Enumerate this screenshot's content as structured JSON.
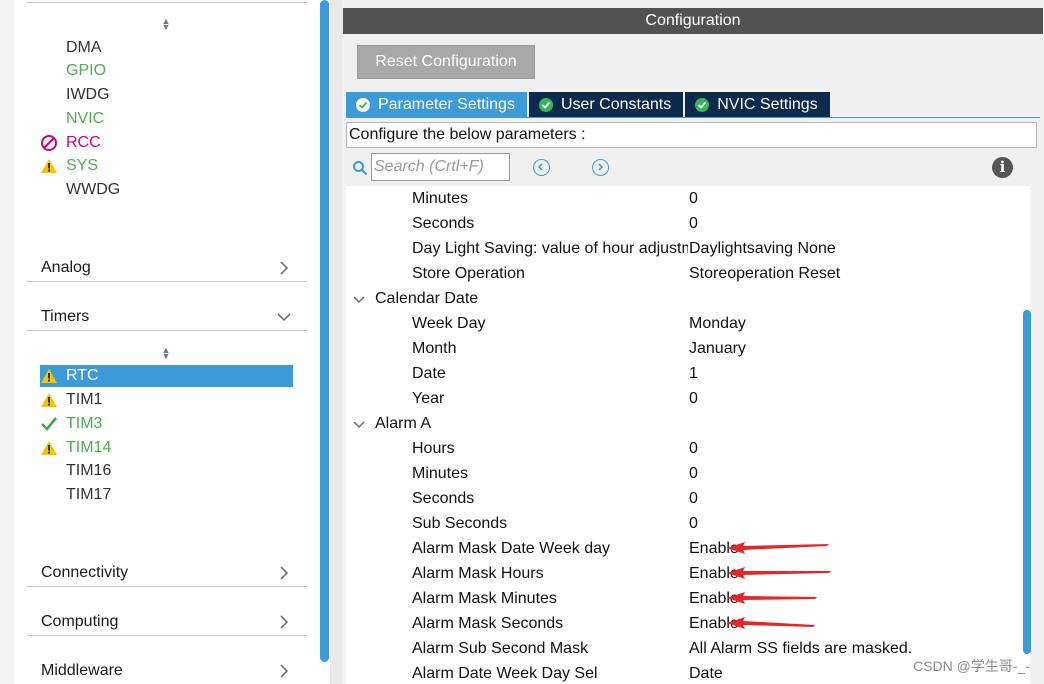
{
  "sidebar": {
    "peripherals": [
      {
        "label": "DMA",
        "color": "#333333",
        "status": "none"
      },
      {
        "label": "GPIO",
        "color": "#4caf50",
        "status": "none"
      },
      {
        "label": "IWDG",
        "color": "#333333",
        "status": "none"
      },
      {
        "label": "NVIC",
        "color": "#4caf50",
        "status": "none"
      },
      {
        "label": "RCC",
        "color": "#d6007a",
        "status": "error"
      },
      {
        "label": "SYS",
        "color": "#4caf50",
        "status": "warning"
      },
      {
        "label": "WWDG",
        "color": "#333333",
        "status": "none"
      }
    ],
    "categories": {
      "analog": "Analog",
      "timers": "Timers",
      "connectivity": "Connectivity",
      "computing": "Computing",
      "middleware": "Middleware"
    },
    "timers": [
      {
        "label": "RTC",
        "status": "warning",
        "selected": true
      },
      {
        "label": "TIM1",
        "status": "warning",
        "selected": false
      },
      {
        "label": "TIM3",
        "status": "ok",
        "selected": false
      },
      {
        "label": "TIM14",
        "status": "warning",
        "selected": false
      },
      {
        "label": "TIM16",
        "status": "none",
        "selected": false
      },
      {
        "label": "TIM17",
        "status": "none",
        "selected": false
      }
    ]
  },
  "config": {
    "header": "Configuration",
    "reset_button": "Reset Configuration",
    "tabs": [
      {
        "label": "Parameter Settings",
        "active": true
      },
      {
        "label": "User Constants",
        "active": false
      },
      {
        "label": "NVIC Settings",
        "active": false
      }
    ],
    "info_text": "Configure the below parameters :",
    "search_placeholder": "Search (Crtl+F)"
  },
  "parameters": {
    "top": [
      {
        "name": "Minutes",
        "value": "0"
      },
      {
        "name": "Seconds",
        "value": "0"
      },
      {
        "name": "Day Light Saving: value of hour adjustm...",
        "value": "Daylightsaving None"
      },
      {
        "name": "Store Operation",
        "value": "Storeoperation Reset"
      }
    ],
    "calendar_date": {
      "title": "Calendar Date",
      "items": [
        {
          "name": "Week Day",
          "value": "Monday"
        },
        {
          "name": "Month",
          "value": "January"
        },
        {
          "name": "Date",
          "value": "1"
        },
        {
          "name": "Year",
          "value": "0"
        }
      ]
    },
    "alarm_a": {
      "title": "Alarm A",
      "items": [
        {
          "name": "Hours",
          "value": "0"
        },
        {
          "name": "Minutes",
          "value": "0"
        },
        {
          "name": "Seconds",
          "value": "0"
        },
        {
          "name": "Sub Seconds",
          "value": "0"
        },
        {
          "name": "Alarm Mask Date Week day",
          "value": "Enable"
        },
        {
          "name": "Alarm Mask Hours",
          "value": "Enable"
        },
        {
          "name": "Alarm Mask Minutes",
          "value": "Enable"
        },
        {
          "name": "Alarm Mask Seconds",
          "value": "Enable"
        },
        {
          "name": "Alarm Sub Second Mask",
          "value": "All Alarm SS fields are masked."
        },
        {
          "name": "Alarm Date Week Day Sel",
          "value": "Date"
        }
      ]
    }
  },
  "watermark": "CSDN @学生哥-_-",
  "colors": {
    "accent": "#3d9ad9",
    "tab_dark": "#0b2a4c",
    "header": "#525252",
    "annotation_arrow": "#e8262a"
  }
}
